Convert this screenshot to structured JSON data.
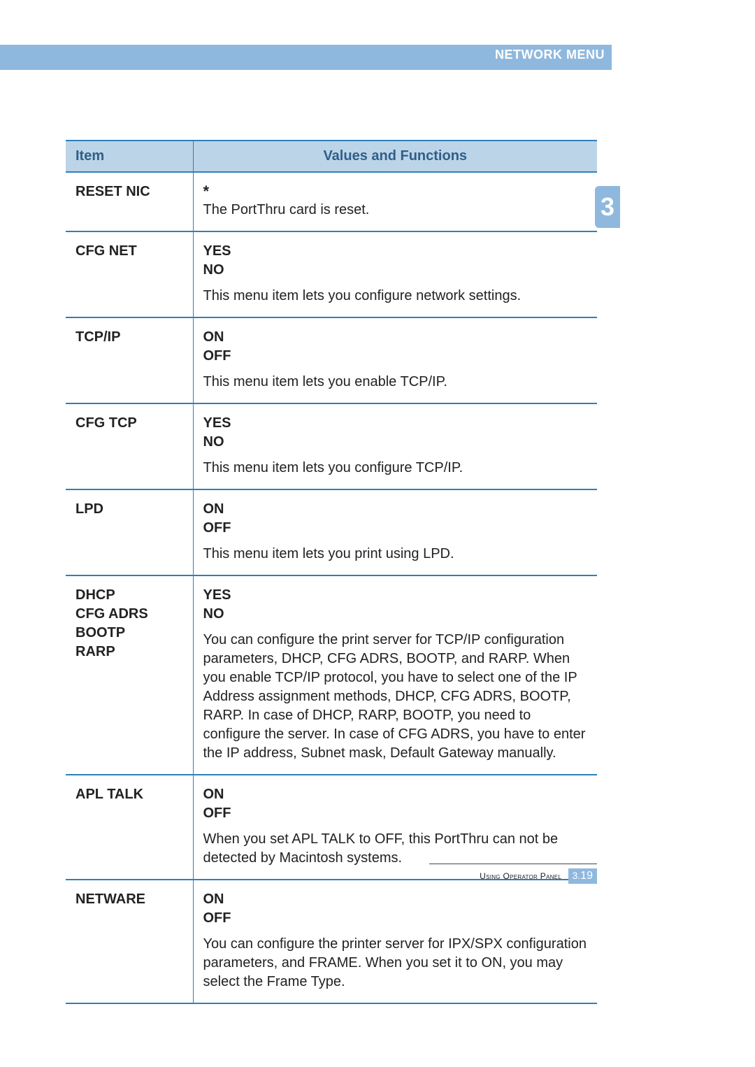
{
  "header": {
    "section_title": "NETWORK MENU"
  },
  "chapter_tab": "3",
  "table": {
    "headers": {
      "item": "Item",
      "values": "Values and Functions"
    },
    "rows": [
      {
        "item": "RESET NIC",
        "values": "*",
        "desc": "The PortThru card is reset."
      },
      {
        "item": "CFG NET",
        "values": "YES\nNO",
        "desc": "This menu item lets you configure network settings."
      },
      {
        "item": "TCP/IP",
        "values": "ON\nOFF",
        "desc": "This menu item lets you enable TCP/IP."
      },
      {
        "item": "CFG TCP",
        "values": "YES\nNO",
        "desc": "This menu item lets you configure TCP/IP."
      },
      {
        "item": "LPD",
        "values": "ON\nOFF",
        "desc": "This menu item lets you print using LPD."
      },
      {
        "item": "DHCP\nCFG ADRS\nBOOTP\nRARP",
        "values": "YES\nNO",
        "desc": "You can configure the print server for TCP/IP configuration parameters, DHCP, CFG ADRS, BOOTP, and RARP. When you enable TCP/IP protocol, you have to select one of the IP Address assignment methods, DHCP, CFG ADRS, BOOTP, RARP. In case of DHCP, RARP, BOOTP, you need to configure the server. In case of CFG ADRS, you have to enter the IP address, Subnet mask, Default Gateway manually."
      },
      {
        "item": "APL TALK",
        "values": "ON\nOFF",
        "desc": "When you set APL TALK to OFF, this PortThru can not be detected by Macintosh systems."
      },
      {
        "item": "NETWARE",
        "values": "ON\nOFF",
        "desc": "You can configure the printer server for IPX/SPX configuration parameters, and FRAME. When you set it to ON, you may select the Frame Type."
      }
    ]
  },
  "footer": {
    "text": "Using Operator Panel",
    "page_chapter": "3.",
    "page_number": "19"
  }
}
